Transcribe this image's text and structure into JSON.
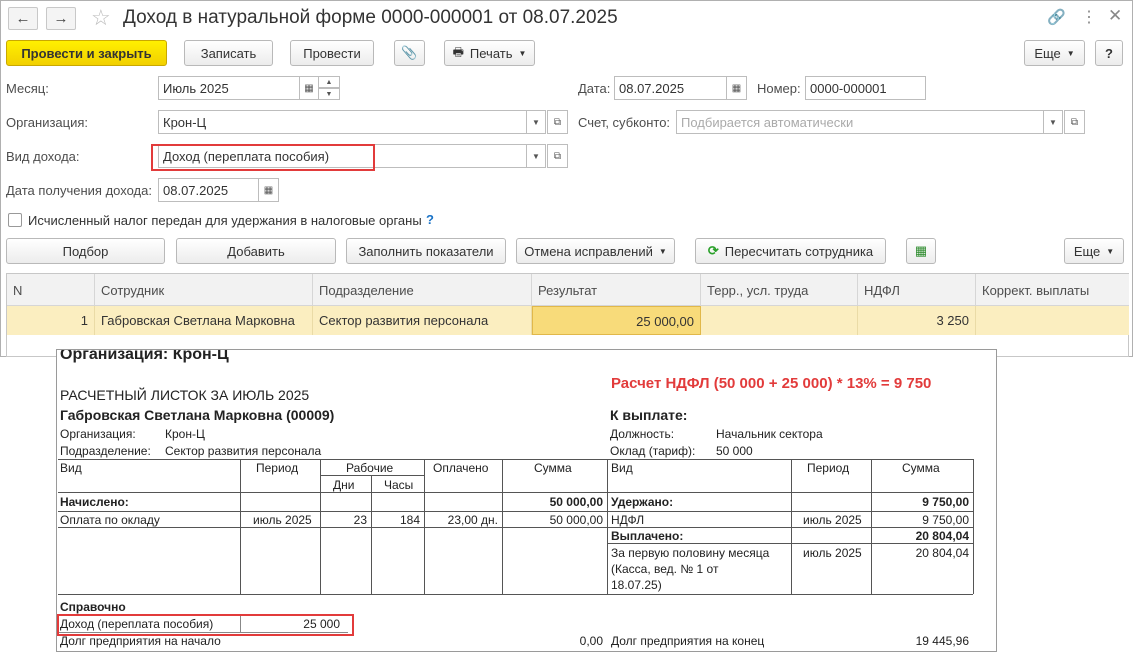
{
  "window": {
    "title": "Доход в натуральной форме 0000-000001 от 08.07.2025"
  },
  "toolbar": {
    "post_close": "Провести и закрыть",
    "save": "Записать",
    "post": "Провести",
    "print": "Печать",
    "more": "Еще",
    "help": "?"
  },
  "form": {
    "month_label": "Месяц:",
    "month_value": "Июль 2025",
    "date_label": "Дата:",
    "date_value": "08.07.2025",
    "number_label": "Номер:",
    "number_value": "0000-000001",
    "org_label": "Организация:",
    "org_value": "Крон-Ц",
    "account_label": "Счет, субконто:",
    "account_placeholder": "Подбирается автоматически",
    "income_type_label": "Вид дохода:",
    "income_type_value": "Доход (переплата пособия)",
    "receipt_date_label": "Дата получения дохода:",
    "receipt_date_value": "08.07.2025",
    "tax_checkbox_label": "Исчисленный налог передан для удержания в налоговые органы",
    "tax_help": "?"
  },
  "table_toolbar": {
    "pick": "Подбор",
    "add": "Добавить",
    "fill": "Заполнить показатели",
    "cancel_fix": "Отмена исправлений",
    "recalc": "Пересчитать сотрудника",
    "more": "Еще"
  },
  "table": {
    "headers": [
      "N",
      "Сотрудник",
      "Подразделение",
      "Результат",
      "Терр., усл. труда",
      "НДФЛ",
      "Коррект. выплаты"
    ],
    "rows": [
      [
        "1",
        "Габровская Светлана Марковна",
        "Сектор развития персонала",
        "25 000,00",
        "",
        "3 250",
        ""
      ]
    ]
  },
  "payslip": {
    "org_title": "Организация: Крон-Ц",
    "heading": "РАСЧЕТНЫЙ ЛИСТОК ЗА ИЮЛЬ 2025",
    "ndfl_note": "Расчет НДФЛ (50 000 + 25 000) * 13% = 9 750",
    "employee": "Габровская Светлана Марковна (00009)",
    "to_pay": "К выплате:",
    "org_label": "Организация:",
    "org_value": "Крон-Ц",
    "dept_label": "Подразделение:",
    "dept_value": "Сектор развития персонала",
    "position_label": "Должность:",
    "position_value": "Начальник сектора",
    "salary_label": "Оклад (тариф):",
    "salary_value": "50 000",
    "left_headers": {
      "kind": "Вид",
      "period": "Период",
      "working": "Рабочие",
      "days": "Дни",
      "hours": "Часы",
      "paid": "Оплачено",
      "sum": "Сумма"
    },
    "right_headers": {
      "kind": "Вид",
      "period": "Период",
      "sum": "Сумма"
    },
    "accrued_label": "Начислено:",
    "accrued_total": "50 000,00",
    "accrual_row": {
      "kind": "Оплата по окладу",
      "period": "июль 2025",
      "days": "23",
      "hours": "184",
      "paid": "23,00 дн.",
      "sum": "50 000,00"
    },
    "withheld_label": "Удержано:",
    "withheld_total": "9 750,00",
    "withheld_row": {
      "kind": "НДФЛ",
      "period": "июль 2025",
      "sum": "9 750,00"
    },
    "paid_label": "Выплачено:",
    "paid_total": "20 804,04",
    "paid_row": {
      "kind_line1": "За первую половину месяца",
      "kind_line2": "(Касса, вед. № 1 от",
      "kind_line3": "18.07.25)",
      "period": "июль 2025",
      "sum": "20 804,04"
    },
    "reference_label": "Справочно",
    "reference_row": {
      "kind": "Доход (переплата пособия)",
      "sum": "25 000"
    },
    "debt_start_label": "Долг предприятия на начало",
    "debt_start_value": "0,00",
    "debt_end_label": "Долг предприятия на конец",
    "debt_end_value": "19 445,96"
  },
  "colors": {
    "primary_button": "#f5d800",
    "accent_red": "#e23b3b",
    "selected_row": "#fbeec0",
    "result_cell": "#f8db7a"
  }
}
